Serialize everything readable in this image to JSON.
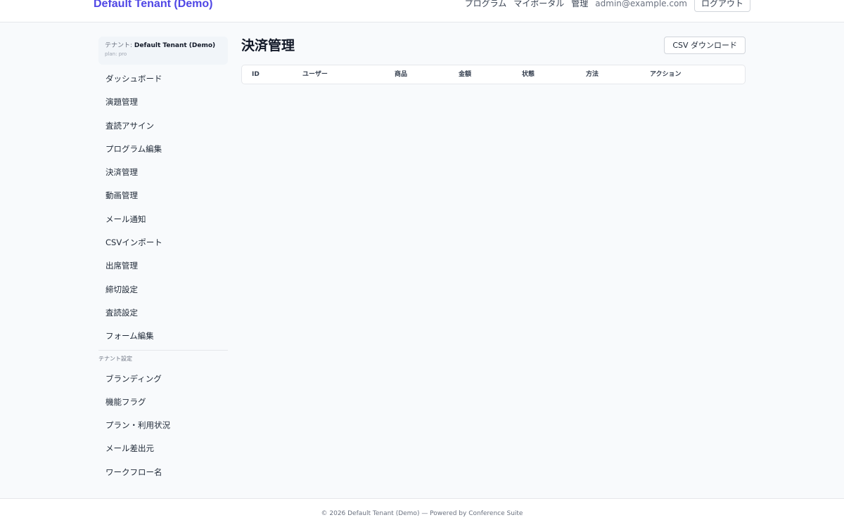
{
  "header": {
    "brand": "Default Tenant (Demo)",
    "nav": [
      "プログラム",
      "マイポータル",
      "管理"
    ],
    "user_email": "admin@example.com",
    "logout_label": "ログアウト"
  },
  "sidebar": {
    "tenant_prefix": "テナント:",
    "tenant_name": "Default Tenant (Demo)",
    "plan": "plan: pro",
    "items": [
      "ダッシュボード",
      "演題管理",
      "査読アサイン",
      "プログラム編集",
      "決済管理",
      "動画管理",
      "メール通知",
      "CSVインポート",
      "出席管理",
      "締切設定",
      "査読設定",
      "フォーム編集"
    ],
    "settings_label": "テナント設定",
    "settings_items": [
      "ブランディング",
      "機能フラグ",
      "プラン・利用状況",
      "メール差出元",
      "ワークフロー名"
    ]
  },
  "main": {
    "title": "決済管理",
    "csv_button": "CSV ダウンロード",
    "columns": [
      "ID",
      "ユーザー",
      "商品",
      "金額",
      "状態",
      "方法",
      "アクション"
    ]
  },
  "footer": {
    "text": "© 2026 Default Tenant (Demo) — Powered by Conference Suite"
  }
}
